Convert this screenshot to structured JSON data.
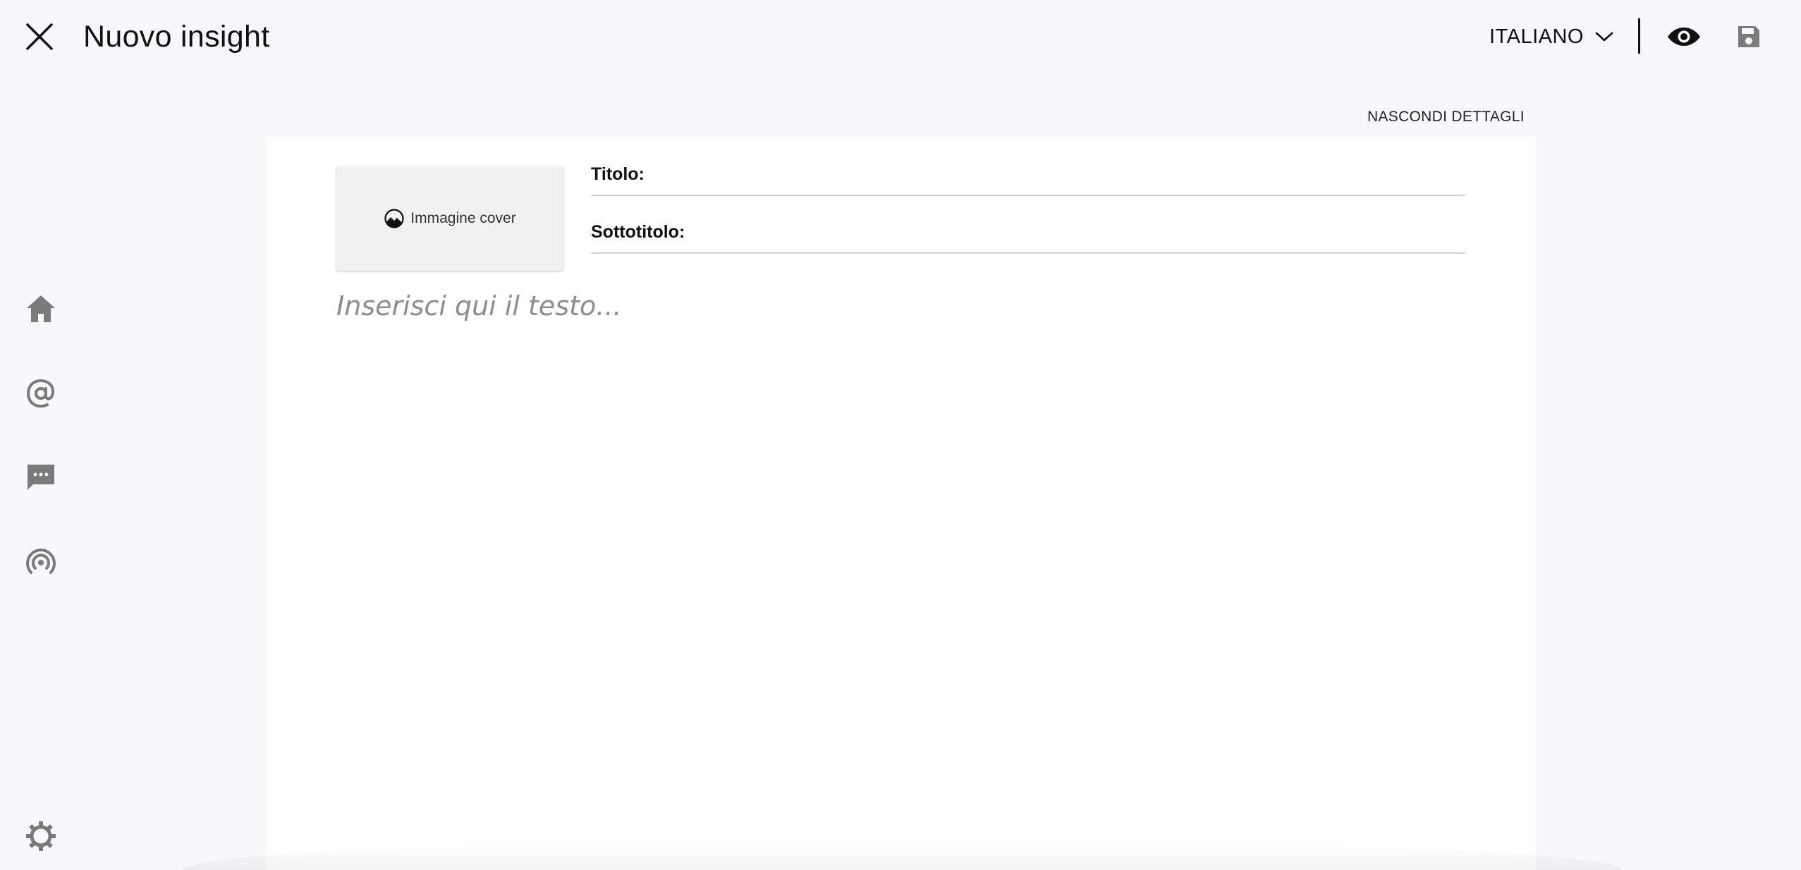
{
  "header": {
    "title": "Nuovo insight",
    "language": "ITALIANO"
  },
  "editor": {
    "details_toggle": "NASCONDI DETTAGLI",
    "cover_label": "Immagine cover",
    "title_label": "Titolo:",
    "subtitle_label": "Sottotitolo:",
    "body_placeholder": "Inserisci qui il testo..."
  },
  "icons": {
    "close": "close-icon",
    "language_dropdown": "chevron-down-icon",
    "preview": "eye-icon",
    "save": "save-icon",
    "cover": "image-icon",
    "sidebar": [
      "home-icon",
      "at-sign-icon",
      "chat-icon",
      "broadcast-icon",
      "gear-icon"
    ]
  },
  "colors": {
    "background": "#f7f8fb",
    "card": "#ffffff",
    "sidebar_icon": "#7a7a7a",
    "placeholder": "#8d8d8d",
    "text": "#111111"
  }
}
